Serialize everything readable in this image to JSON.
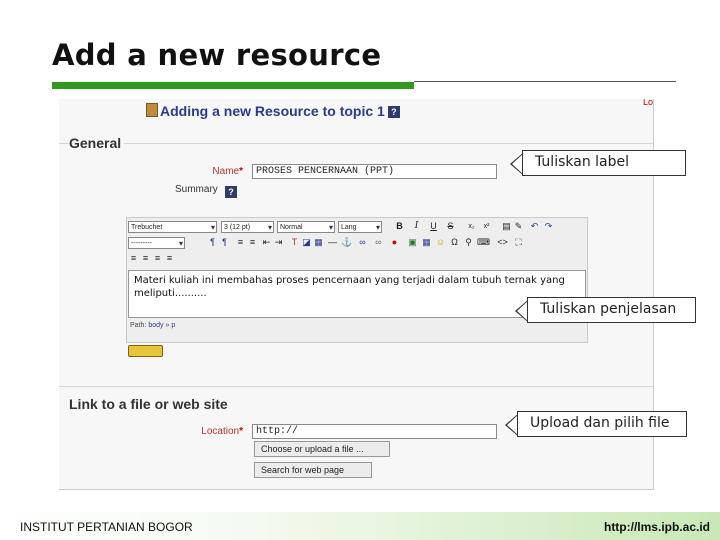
{
  "slide": {
    "title": "Add a new resource"
  },
  "screenshot": {
    "heading": "Adding a new Resource to topic 1",
    "help_glyph": "?",
    "login_fragment": "Lo",
    "general": {
      "legend": "General",
      "name_label": "Name",
      "name_value": "PROSES PENCERNAAN (PPT)",
      "summary_label": "Summary",
      "required_mark": "*"
    },
    "editor": {
      "font_family": "Trebuchet",
      "font_size": "3 (12 pt)",
      "style": "Normal",
      "language": "Lang",
      "heading_select": "---------",
      "content": "Materi kuliah ini membahas proses pencernaan yang terjadi dalam tubuh ternak yang meliputi..........",
      "path_label": "Path:",
      "path_body": "body",
      "path_sep": "»",
      "path_p": "p"
    },
    "link": {
      "legend": "Link to a file or web site",
      "location_label": "Location",
      "location_value": "http://",
      "choose_button": "Choose or upload a file ...",
      "search_button": "Search for web page"
    }
  },
  "callouts": {
    "label": "Tuliskan label",
    "description": "Tuliskan penjelasan",
    "upload": "Upload dan pilih file"
  },
  "footer": {
    "institution": "INSTITUT PERTANIAN BOGOR",
    "url": "http://lms.ipb.ac.id"
  },
  "colors": {
    "accent_green": "#2e9a1e",
    "heading_blue": "#2a3b8f",
    "required_red": "#cc0000"
  }
}
